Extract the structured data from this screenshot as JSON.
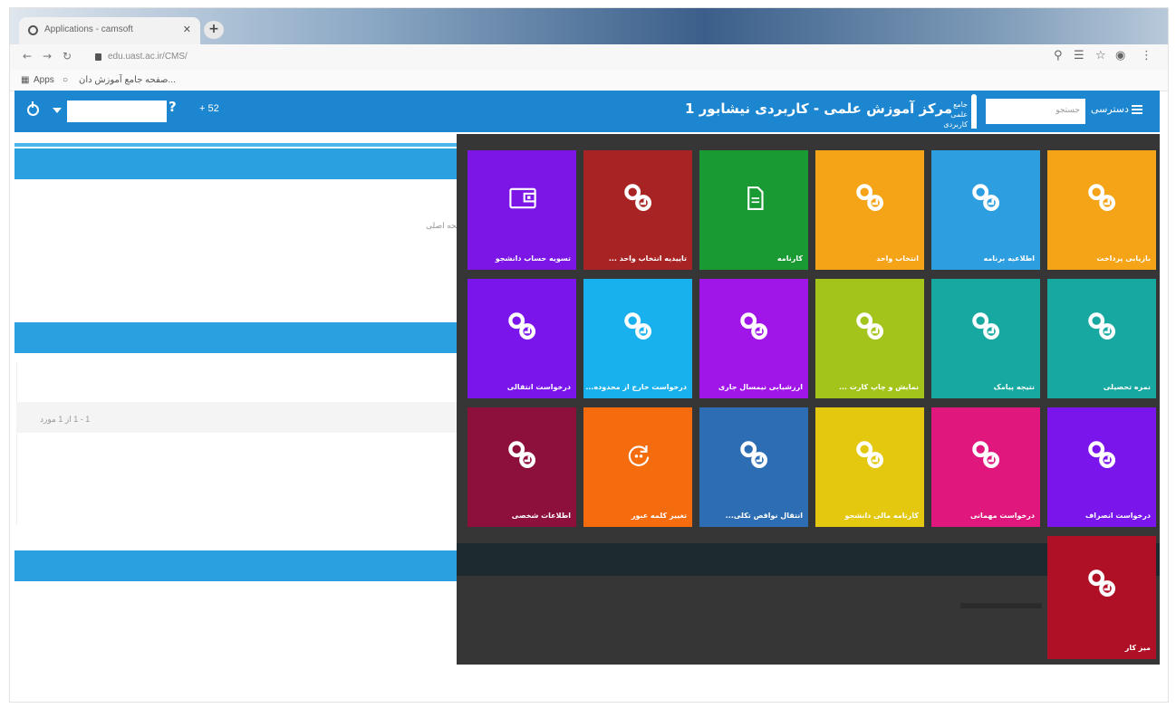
{
  "browser": {
    "tab_title": "Applications - camsoft",
    "tab_close": "✕",
    "new_tab": "+",
    "url": "edu.uast.ac.ir/CMS/",
    "bookmarks": [
      {
        "label": "Apps"
      },
      {
        "label": "صفحه جامع آموزش ‌دان..."
      }
    ]
  },
  "header": {
    "title": "مرکز آموزش علمی - کاربردی نیشابور 1",
    "logo_text": "جامع علمی\nکاربردی",
    "search_placeholder": "جستجو",
    "menu_label": "دسترسی",
    "help": "?",
    "mini_label": "+ 52"
  },
  "content": {
    "panel_note": "صفحه اصلی",
    "pagination_text": "1 - 1 از 1 مورد"
  },
  "colors": {
    "header_bg": "#1c86d1",
    "section_bar": "#2aa0e0",
    "overlay_bg": "#363636"
  },
  "tiles": [
    {
      "label": "بازیابی پرداخت",
      "color": "#f5a317",
      "icon": "link-icon"
    },
    {
      "label": "اطلاعیه برنامه",
      "color": "#2d9fe1",
      "icon": "link-icon"
    },
    {
      "label": "انتخاب واحد",
      "color": "#f5a317",
      "icon": "link-icon"
    },
    {
      "label": "کارنامه",
      "color": "#1a9a32",
      "icon": "document-icon"
    },
    {
      "label": "تاییدیه انتخاب واحد ...",
      "color": "#a82424",
      "icon": "link-icon"
    },
    {
      "label": "تسویه حساب دانشجو",
      "color": "#7b16e6",
      "icon": "wallet-icon"
    },
    {
      "label": "نمره تحصیلی",
      "color": "#17a8a2",
      "icon": "link-icon"
    },
    {
      "label": "نتیجه پیامک",
      "color": "#17a8a2",
      "icon": "link-icon"
    },
    {
      "label": "نمایش و چاپ کارت ...",
      "color": "#a3c41a",
      "icon": "link-icon"
    },
    {
      "label": "ارزشیابی نیمسال جاری",
      "color": "#a015e8",
      "icon": "link-icon"
    },
    {
      "label": "درخواست خارج از محدوده...",
      "color": "#18b1ee",
      "icon": "link-icon"
    },
    {
      "label": "درخواست انتقالی",
      "color": "#7a16ec",
      "icon": "link-icon"
    },
    {
      "label": "درخواست انصراف",
      "color": "#7a16ec",
      "icon": "link-icon"
    },
    {
      "label": "درخواست مهمانی",
      "color": "#e0177c",
      "icon": "link-icon"
    },
    {
      "label": "کارنامه مالی دانشجو",
      "color": "#e4c80f",
      "icon": "link-icon"
    },
    {
      "label": "انتقال نواقص تکلی...",
      "color": "#2d6db4",
      "icon": "link-icon"
    },
    {
      "label": "تغییر کلمه عبور",
      "color": "#f56c0e",
      "icon": "refresh-icon"
    },
    {
      "label": "اطلاعات شخصی",
      "color": "#8c0f3c",
      "icon": "link-icon"
    },
    {
      "label": "میز کار",
      "color": "#b01025",
      "icon": "link-icon"
    }
  ]
}
